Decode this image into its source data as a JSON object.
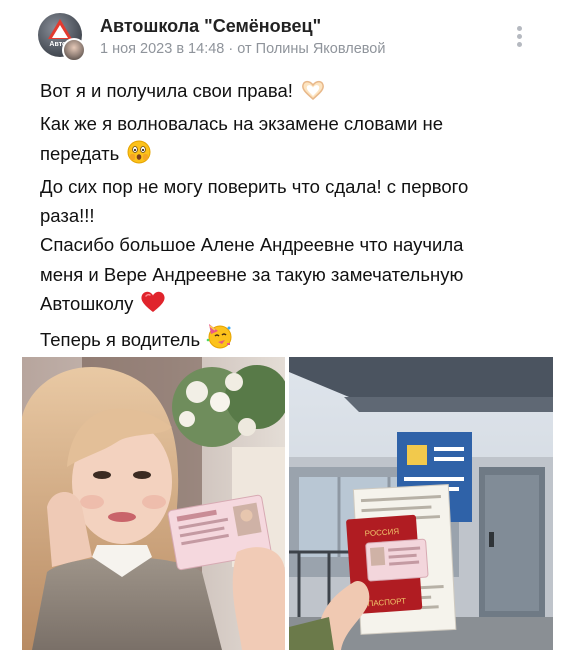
{
  "post": {
    "author": "Автошкола \"Семёновец\"",
    "date_line": "1 ноя 2023 в 14:48 · от Полины Яковлевой",
    "avatar_text": "Автор",
    "lines": [
      "Вот я и получила свои права!",
      "Как же я волновалась на экзамене словами не",
      "передать",
      "До сих пор не могу поверить что сдала! с первого",
      "раза!!!",
      "Спасибо большое Алене Андреевне что научила",
      "меня и Вере Андреевне за такую замечательную",
      "Автошколу",
      "Теперь я водитель"
    ],
    "emojis": {
      "hands": "heart-hands-emoji",
      "shocked": "astonished-face-emoji",
      "heart": "red-heart-emoji",
      "party": "partying-face-emoji"
    },
    "photos": [
      {
        "name": "photo-girl-with-license",
        "card_text": ""
      },
      {
        "name": "photo-documents-at-building",
        "doc_label_top": "РОССИЯ",
        "doc_label_bottom": "ПАСПОРТ"
      }
    ],
    "colors": {
      "title": "#222222",
      "meta": "#8f949b",
      "heart": "#e0242c"
    }
  }
}
